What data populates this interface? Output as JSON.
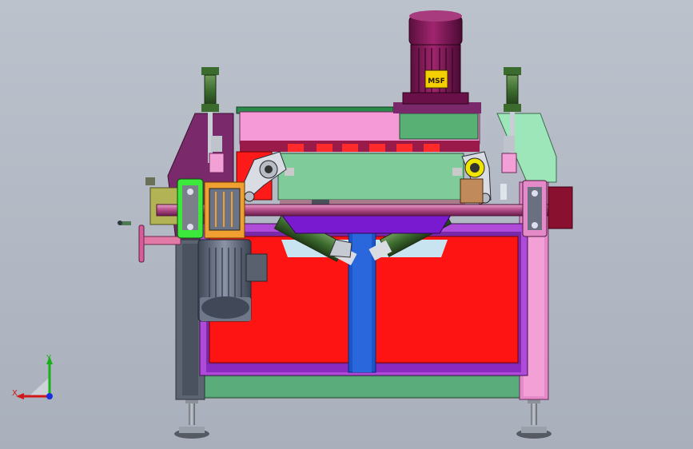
{
  "view": {
    "background_top": "#bcc2cc",
    "background_bottom": "#a9b0bc"
  },
  "machine": {
    "motor_nameplate": "MSF",
    "colors": {
      "frame_magenta": "#7a2a6a",
      "frame_pink": "#e48ac8",
      "frame_green": "#9de6b9",
      "enclosure_red": "#ff1414",
      "enclosure_purple_border": "#b04ad8",
      "center_blue_column": "#1c55c8",
      "top_plate_pink": "#f59ad6",
      "top_plate_green_panel": "#59b074",
      "motor_body": "#8a1a5e",
      "motor_nameplate_bg": "#f5d000",
      "bottom_base": "#54a071",
      "inner_panel_green": "#7fcc9a",
      "cylinder_green": "#3c6b2e",
      "handwheel_pink": "#d65d9a",
      "gear_orange": "#f0a030",
      "grey_motor": "#6a7486"
    }
  },
  "triad": {
    "x_label": "X",
    "y_label": "Y",
    "x_color": "#d01818",
    "y_color": "#18b018",
    "z_color": "#1a2ee0"
  }
}
